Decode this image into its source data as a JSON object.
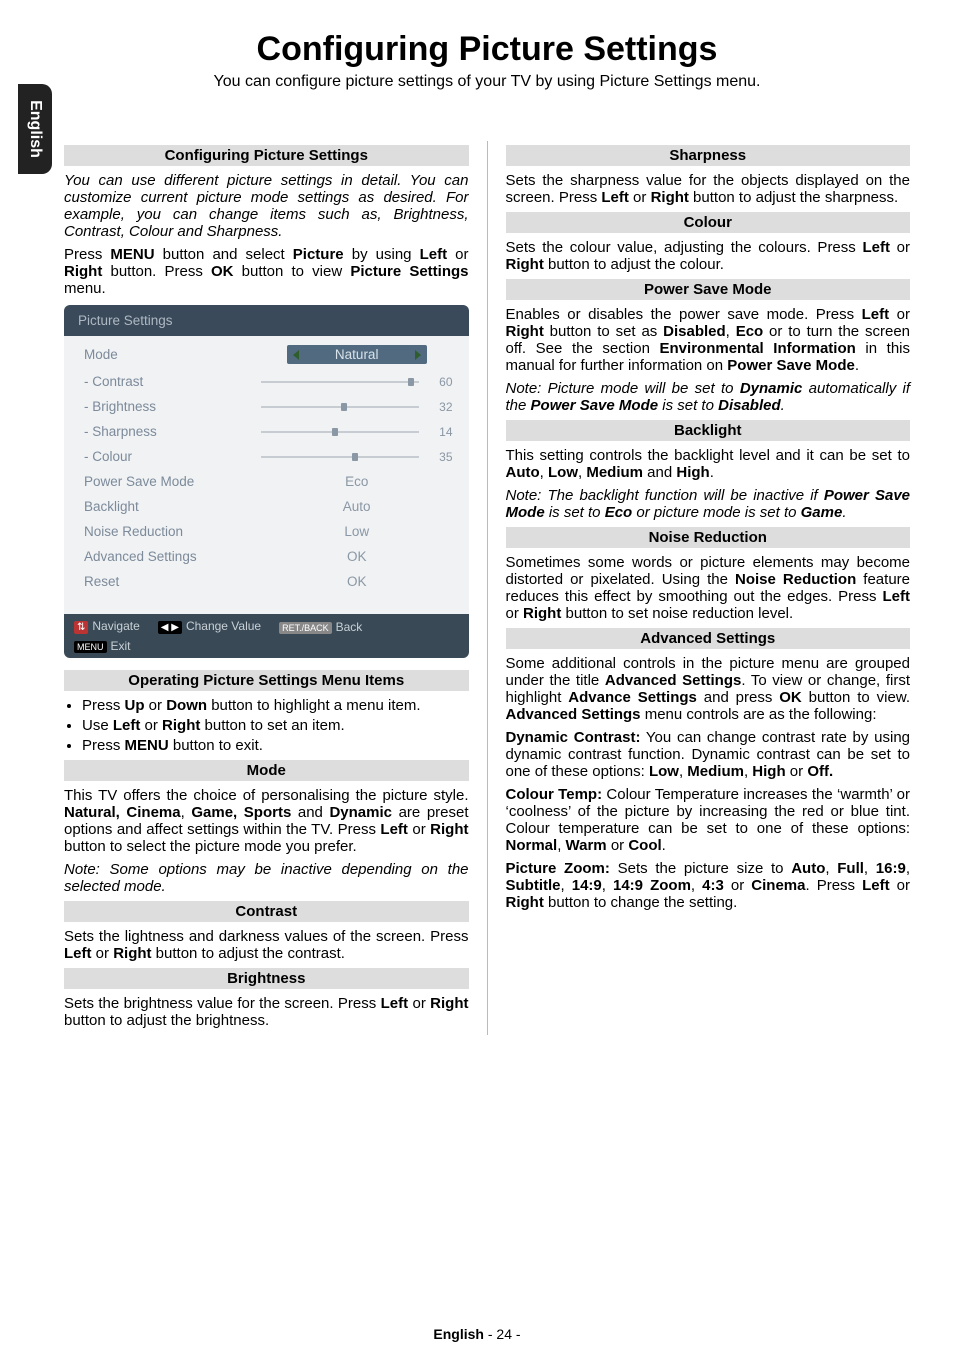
{
  "lang_tab": "English",
  "title": "Configuring Picture Settings",
  "subtitle": "You can configure picture settings of your TV by using Picture Settings menu.",
  "left": {
    "sec_configuring": {
      "heading": "Configuring Picture Settings",
      "p1_parts": [
        "You can use different picture settings in detail. You can customize current picture mode settings as desired. For example, you can change items such as, Brightness, Contrast, Colour and Sharpness."
      ],
      "p2_pre": "Press ",
      "p2_b1": "MENU",
      "p2_mid1": " button and select ",
      "p2_b2": "Picture",
      "p2_mid2": " by using ",
      "p2_b3": "Left",
      "p2_mid3": " or ",
      "p2_b4": "Right",
      "p2_mid4": " button. Press ",
      "p2_b5": "OK",
      "p2_mid5": " button to view ",
      "p2_b6": "Picture Settings",
      "p2_end": " menu."
    },
    "menu": {
      "header": "Picture Settings",
      "rows": {
        "mode": {
          "label": "Mode",
          "value": "Natural"
        },
        "contrast": {
          "label": "- Contrast",
          "value": "60",
          "pct": 95
        },
        "brightness": {
          "label": "- Brightness",
          "value": "32",
          "pct": 53
        },
        "sharpness": {
          "label": "- Sharpness",
          "value": "14",
          "pct": 47
        },
        "colour": {
          "label": "- Colour",
          "value": "35",
          "pct": 60
        },
        "psm": {
          "label": "Power Save Mode",
          "value": "Eco"
        },
        "backlight": {
          "label": "Backlight",
          "value": "Auto"
        },
        "noise": {
          "label": "Noise Reduction",
          "value": "Low"
        },
        "adv": {
          "label": "Advanced Settings",
          "value": "OK"
        },
        "reset": {
          "label": "Reset",
          "value": "OK"
        }
      },
      "footer": {
        "nav": "Navigate",
        "change": "Change Value",
        "back": "Back",
        "exit": "Exit",
        "retback": "RET./BACK",
        "menukey": "MENU"
      }
    },
    "sec_operating": {
      "heading": "Operating Picture Settings Menu Items",
      "li1_pre": "Press ",
      "li1_b1": "Up",
      "li1_mid": " or ",
      "li1_b2": "Down",
      "li1_end": " button to highlight a menu item.",
      "li2_pre": "Use ",
      "li2_b1": "Left",
      "li2_mid": " or ",
      "li2_b2": "Right",
      "li2_end": " button to set an item.",
      "li3_pre": "Press ",
      "li3_b1": "MENU",
      "li3_end": " button to exit."
    },
    "sec_mode": {
      "heading": "Mode",
      "p1_pre": "This TV offers the choice of personalising the picture style. ",
      "p1_b1": "Natural, Cinema",
      "p1_mid1": ", ",
      "p1_b2": "Game, Sports",
      "p1_mid2": " and ",
      "p1_b3": "Dynamic",
      "p1_mid3": " are preset options and affect settings within the TV. Press ",
      "p1_b4": "Left",
      "p1_mid4": " or ",
      "p1_b5": "Right",
      "p1_end": " button to select the picture mode you prefer.",
      "note": "Note: Some options may be inactive depending on the selected mode."
    },
    "sec_contrast": {
      "heading": "Contrast",
      "p_pre": "Sets the lightness and darkness values of the screen. Press ",
      "p_b1": "Left",
      "p_mid": " or ",
      "p_b2": "Right",
      "p_end": " button to adjust the contrast."
    },
    "sec_brightness": {
      "heading": "Brightness",
      "p_pre": "Sets the brightness value for the screen. Press ",
      "p_b1": "Left",
      "p_mid": " or ",
      "p_b2": "Right",
      "p_end": " button to adjust the brightness."
    }
  },
  "right": {
    "sec_sharpness": {
      "heading": "Sharpness",
      "p_pre": "Sets the sharpness value for the objects displayed on the screen. Press ",
      "p_b1": "Left",
      "p_mid": " or ",
      "p_b2": "Right",
      "p_end": " button to adjust the sharpness."
    },
    "sec_colour": {
      "heading": "Colour",
      "p_pre": "Sets the colour value, adjusting the colours. Press ",
      "p_b1": "Left",
      "p_mid": " or ",
      "p_b2": "Right",
      "p_end": " button to adjust the colour."
    },
    "sec_psm": {
      "heading": "Power Save Mode",
      "p1_pre": "Enables or disables the power save mode. Press ",
      "p1_b1": "Left",
      "p1_mid1": " or ",
      "p1_b2": "Right",
      "p1_mid2": " button to set as ",
      "p1_b3": "Disabled",
      "p1_mid3": ", ",
      "p1_b4": "Eco",
      "p1_mid4": " or to turn the screen off. See the section ",
      "p1_b5": "Environmental Information",
      "p1_mid5": " in this manual for further information on ",
      "p1_b6": "Power Save Mode",
      "p1_end": ".",
      "note_pre": "Note: Picture mode will be set to ",
      "note_b1": "Dynamic",
      "note_mid": " automatically if the ",
      "note_b2": "Power Save Mode",
      "note_mid2": " is set to ",
      "note_b3": "Disabled",
      "note_end": "."
    },
    "sec_backlight": {
      "heading": "Backlight",
      "p_pre": "This setting controls the backlight level and it can be set to ",
      "p_b1": "Auto",
      "p_m1": ", ",
      "p_b2": "Low",
      "p_m2": ", ",
      "p_b3": "Medium",
      "p_m3": " and ",
      "p_b4": "High",
      "p_end": ".",
      "note_pre": "Note: The backlight function will be inactive if ",
      "note_b1": "Power Save Mode",
      "note_mid1": " is set to ",
      "note_b2": "Eco",
      "note_mid2": " or picture mode is set to ",
      "note_b3": "Game",
      "note_end": "."
    },
    "sec_noise": {
      "heading": "Noise Reduction",
      "p_pre": "Sometimes some words or picture elements may become distorted or pixelated. Using the ",
      "p_b1": "Noise Reduction",
      "p_mid": " feature reduces this effect by smoothing out the edges. Press ",
      "p_b2": "Left",
      "p_mid2": " or ",
      "p_b3": "Right",
      "p_end": " button to set noise reduction level."
    },
    "sec_adv": {
      "heading": "Advanced Settings",
      "p1_pre": "Some additional controls in the picture menu are grouped under the title ",
      "p1_b1": "Advanced Settings",
      "p1_mid1": ". To view or change, first highlight ",
      "p1_b2": "Advance Settings",
      "p1_mid2": " and press ",
      "p1_b3": "OK",
      "p1_mid3": " button to view. ",
      "p1_b4": "Advanced Settings",
      "p1_end": " menu controls are as the following:",
      "dc_b": "Dynamic Contrast:",
      "dc_txt_pre": " You can change contrast rate by using dynamic contrast function. Dynamic contrast can be set to one of these options: ",
      "dc_b1": "Low",
      "dc_m1": ", ",
      "dc_b2": "Medium",
      "dc_m2": ", ",
      "dc_b3": "High",
      "dc_m3": " or ",
      "dc_b4": "Off.",
      "dc_end": "",
      "ct_b": "Colour Temp:",
      "ct_txt_pre": " Colour Temperature increases the ‘warmth’ or ‘coolness’ of the picture by increasing the red or blue tint. Colour temperature can be set to one of these options: ",
      "ct_b1": "Normal",
      "ct_m1": ", ",
      "ct_b2": "Warm",
      "ct_m2": " or ",
      "ct_b3": "Cool",
      "ct_end": ".",
      "pz_b": "Picture Zoom:",
      "pz_pre": " Sets the picture size to ",
      "pz_b1": "Auto",
      "pz_m1": ", ",
      "pz_b2": "Full",
      "pz_m2": ", ",
      "pz_b3": "16:9",
      "pz_m3": ", ",
      "pz_b4": "Subtitle",
      "pz_m4": ", ",
      "pz_b5": "14:9",
      "pz_m5": ", ",
      "pz_b6": "14:9 Zoom",
      "pz_m6": ", ",
      "pz_b7": "4:3",
      "pz_m7": " or ",
      "pz_b8": "Cinema",
      "pz_m8": ". Press ",
      "pz_b9": "Left",
      "pz_m9": " or ",
      "pz_b10": "Right",
      "pz_end": " button to change the setting."
    }
  },
  "footer": {
    "b": "English",
    "rest": "   - 24 -"
  }
}
